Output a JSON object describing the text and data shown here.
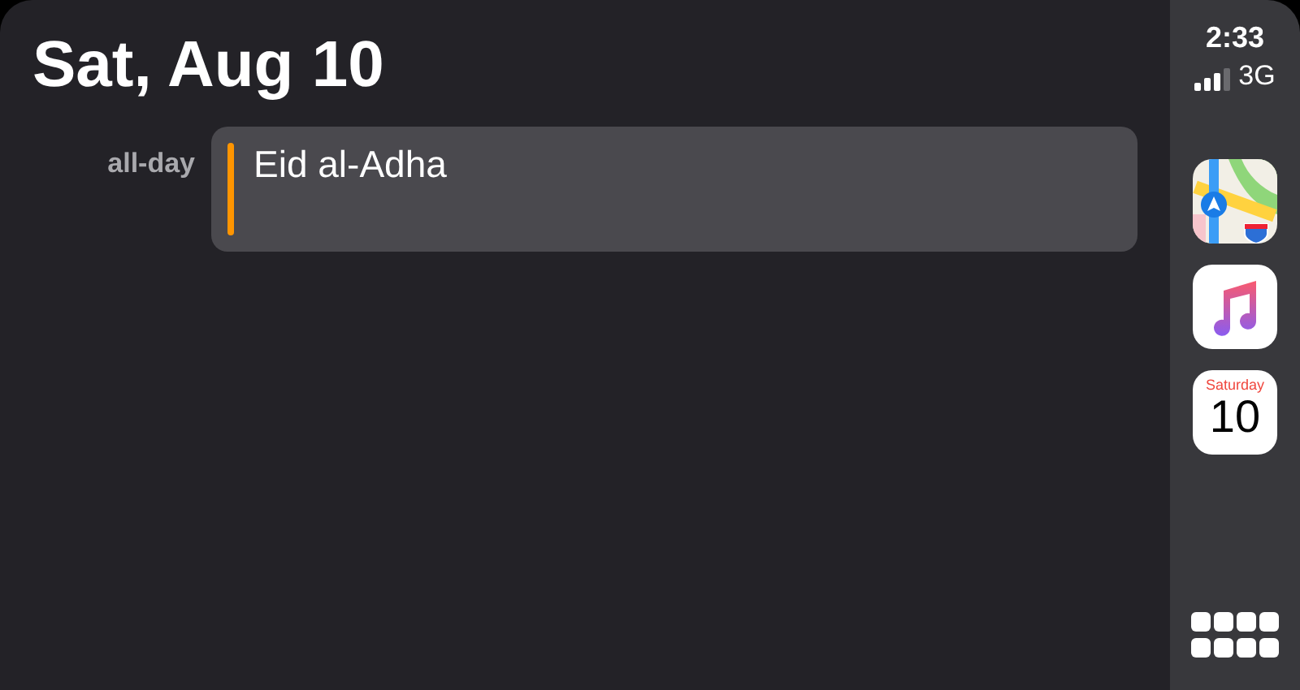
{
  "header": {
    "title": "Sat, Aug 10"
  },
  "events": [
    {
      "time_label": "all-day",
      "title": "Eid al-Adha",
      "color": "#ff9500"
    }
  ],
  "sidebar": {
    "time": "2:33",
    "network": "3G",
    "apps": [
      {
        "kind": "maps"
      },
      {
        "kind": "music"
      },
      {
        "kind": "calendar",
        "weekday": "Saturday",
        "day": "10"
      }
    ]
  }
}
